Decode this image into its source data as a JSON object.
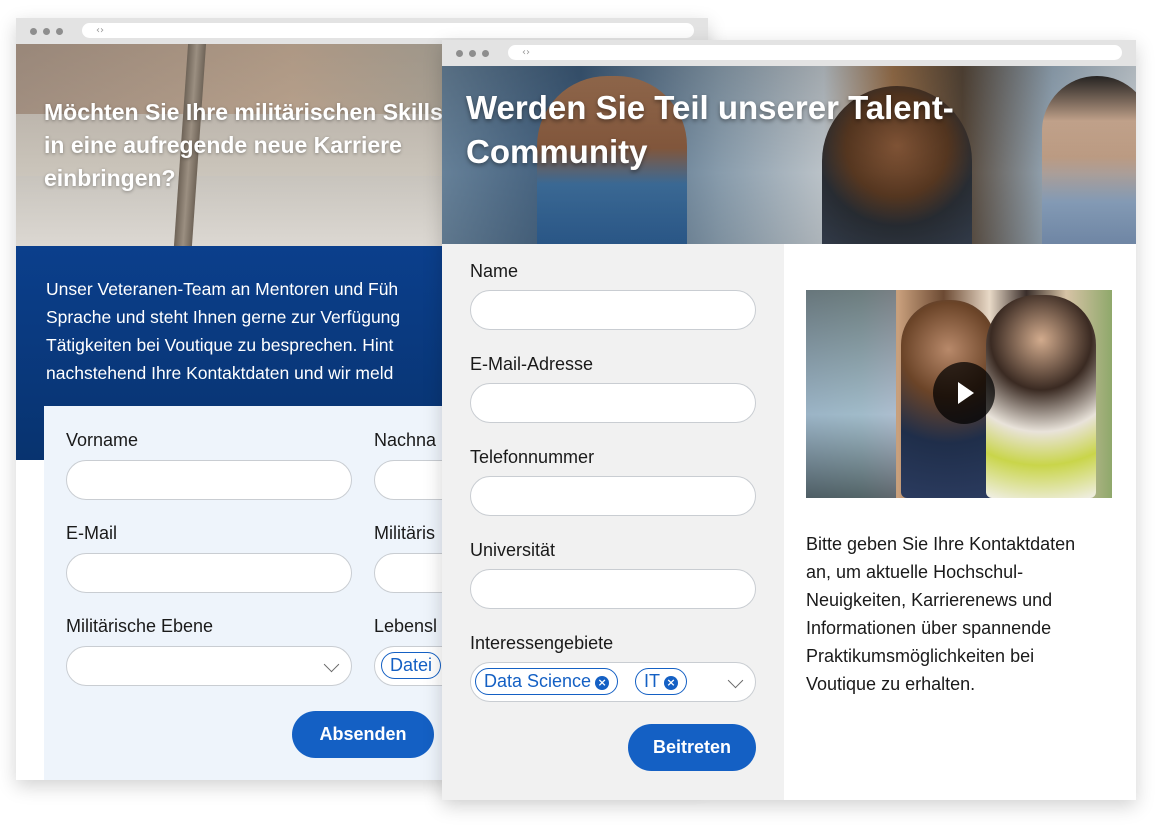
{
  "back_window": {
    "title": "Möchten Sie Ihre militärischen Skills in eine aufregende neue Karriere einbringen?",
    "intro_lines": [
      "Unser Veteranen-Team an Mentoren und Füh",
      "Sprache und steht Ihnen gerne zur Verfügung",
      "Tätigkeiten bei Voutique zu besprechen. Hint",
      "nachstehend Ihre Kontaktdaten und wir meld"
    ],
    "form": {
      "first_name_label": "Vorname",
      "last_name_label": "Nachna",
      "email_label": "E-Mail",
      "military_label": "Militäris",
      "military_level_label": "Militärische Ebene",
      "resume_label": "Lebensl",
      "resume_chip": "Datei",
      "submit_label": "Absenden"
    }
  },
  "front_window": {
    "title": "Werden Sie Teil unserer Talent-Community",
    "form": {
      "name_label": "Name",
      "email_label": "E-Mail-Adresse",
      "phone_label": "Telefonnummer",
      "university_label": "Universität",
      "interests_label": "Interessengebiete",
      "interest_chips": [
        "Data Science",
        "IT"
      ],
      "submit_label": "Beitreten"
    },
    "description_lines": [
      "Bitte geben Sie Ihre Kontaktdaten",
      "an, um aktuelle Hochschul-",
      "Neuigkeiten, Karrierenews und",
      "Informationen über spannende",
      "Praktikumsmöglichkeiten bei",
      "Voutique zu erhalten."
    ]
  },
  "icons": {
    "nav_arrows": "‹›",
    "chip_remove": "×"
  },
  "colors": {
    "accent": "#1460c4",
    "banner_blue": "#0b3f8c",
    "form_bg": "#eef4fb"
  }
}
